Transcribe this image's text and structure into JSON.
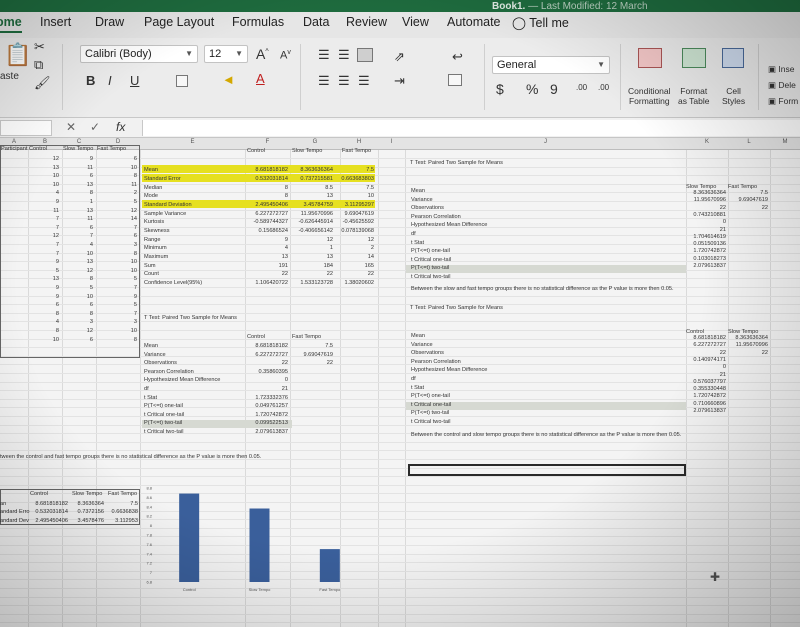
{
  "title_bar": {
    "file": "Book1.",
    "modified": "— Last Modified: 12 March"
  },
  "tabs": [
    "ome",
    "Insert",
    "Draw",
    "Page Layout",
    "Formulas",
    "Data",
    "Review",
    "View",
    "Automate"
  ],
  "tell_me": "Tell me",
  "ribbon": {
    "paste": "aste",
    "font_name": "Calibri (Body)",
    "font_size": "12",
    "grow_font": "A",
    "shrink_font": "A",
    "bold": "B",
    "italic": "I",
    "underline": "U",
    "number_format": "General",
    "currency": "$",
    "percent": "%",
    "comma": "9",
    "increase_decimal": ".00",
    "decrease_decimal": ".00",
    "conditional_formatting": [
      "Conditional",
      "Formatting"
    ],
    "format_as_table": [
      "Format",
      "as Table"
    ],
    "cell_styles": [
      "Cell",
      "Styles"
    ],
    "insert": "Inse",
    "delete": "Dele",
    "format": "Form"
  },
  "formula_bar": {
    "fx": "fx",
    "cancel": "✕",
    "enter": "✓"
  },
  "columns": [
    "A",
    "B",
    "C",
    "D",
    "E",
    "F",
    "G",
    "H",
    "I",
    "J",
    "K",
    "L",
    "M"
  ],
  "data_table": {
    "headers": [
      "Participant",
      "Control",
      "Slow Tempo",
      "Fast Tempo"
    ],
    "rows": [
      [
        "",
        "12",
        "9",
        "6"
      ],
      [
        "",
        "13",
        "11",
        "10"
      ],
      [
        "",
        "10",
        "6",
        "8"
      ],
      [
        "",
        "10",
        "13",
        "11"
      ],
      [
        "",
        "4",
        "8",
        "2"
      ],
      [
        "",
        "9",
        "1",
        "5"
      ],
      [
        "",
        "11",
        "13",
        "12"
      ],
      [
        "",
        "7",
        "11",
        "14"
      ],
      [
        "",
        "7",
        "6",
        "7"
      ],
      [
        "",
        "12",
        "7",
        "6"
      ],
      [
        "",
        "7",
        "4",
        "3"
      ],
      [
        "",
        "7",
        "10",
        "8"
      ],
      [
        "",
        "9",
        "13",
        "10"
      ],
      [
        "",
        "5",
        "12",
        "10"
      ],
      [
        "",
        "13",
        "8",
        "5"
      ],
      [
        "",
        "9",
        "5",
        "7"
      ],
      [
        "",
        "9",
        "10",
        "9"
      ],
      [
        "",
        "6",
        "6",
        "5"
      ],
      [
        "",
        "8",
        "8",
        "7"
      ],
      [
        "",
        "4",
        "3",
        "3"
      ],
      [
        "",
        "8",
        "12",
        "10"
      ],
      [
        "",
        "10",
        "6",
        "8"
      ]
    ]
  },
  "descriptive_stats": {
    "headers": [
      "Control",
      "Slow Tempo",
      "Fast Tempo"
    ],
    "rows": [
      [
        "Mean",
        "8.681818182",
        "8.363636364",
        "7.5"
      ],
      [
        "Standard Error",
        "0.532031814",
        "0.737215581",
        "0.663683803"
      ],
      [
        "Median",
        "8",
        "8.5",
        "7.5"
      ],
      [
        "Mode",
        "8",
        "13",
        "10"
      ],
      [
        "Standard Deviation",
        "2.495450406",
        "3.45784759",
        "3.11295297"
      ],
      [
        "Sample Variance",
        "6.227272727",
        "11.95670996",
        "9.69047619"
      ],
      [
        "Kurtosis",
        "-0.589744327",
        "-0.626445914",
        "-0.45625592"
      ],
      [
        "Skewness",
        "0.15686524",
        "-0.406656142",
        "0.078139068"
      ],
      [
        "Range",
        "9",
        "12",
        "12"
      ],
      [
        "Minimum",
        "4",
        "1",
        "2"
      ],
      [
        "Maximum",
        "13",
        "13",
        "14"
      ],
      [
        "Sum",
        "191",
        "184",
        "165"
      ],
      [
        "Count",
        "22",
        "22",
        "22"
      ],
      [
        "Confidence Level(95%)",
        "1.106420722",
        "1.533123728",
        "1.38020602"
      ]
    ]
  },
  "ttest_left": {
    "title": "T Test: Paired Two Sample for Means",
    "headers": [
      "Control",
      "Fast Tempo"
    ],
    "rows": [
      [
        "Mean",
        "8.681818182",
        "7.5"
      ],
      [
        "Variance",
        "6.227272727",
        "9.69047619"
      ],
      [
        "Observations",
        "22",
        "22"
      ],
      [
        "Pearson Correlation",
        "0.35860395",
        ""
      ],
      [
        "Hypothesized Mean Difference",
        "0",
        ""
      ],
      [
        "df",
        "21",
        ""
      ],
      [
        "t Stat",
        "1.723332376",
        ""
      ],
      [
        "P(T<=t) one-tail",
        "0.049761257",
        ""
      ],
      [
        "t Critical one-tail",
        "1.720742872",
        ""
      ],
      [
        "P(T<=t) two-tail",
        "0.099522513",
        ""
      ],
      [
        "t Critical two-tail",
        "2.079613837",
        ""
      ]
    ],
    "conclusion": "tween the control and fast tempo groups there is no statistical difference as the P value is more then 0.05."
  },
  "ttest_right_top": {
    "title": "T Test: Paired Two Sample for Means",
    "headers": [
      "Slow Tempo",
      "Fast Tempo"
    ],
    "labels": [
      "Mean",
      "Variance",
      "Observations",
      "Pearson Correlation",
      "Hypothesized Mean Difference",
      "df",
      "t Stat",
      "P(T<=t) one-tail",
      "t Critical one-tail",
      "P(T<=t) two-tail",
      "t Critical two-tail"
    ],
    "values": [
      [
        "8.363636364",
        "7.5"
      ],
      [
        "11.95670996",
        "9.69047619"
      ],
      [
        "22",
        "22"
      ],
      [
        "0.743210881",
        ""
      ],
      [
        "0",
        ""
      ],
      [
        "21",
        ""
      ],
      [
        "1.704614619",
        ""
      ],
      [
        "0.051509136",
        ""
      ],
      [
        "1.720742872",
        ""
      ],
      [
        "0.103018273",
        ""
      ],
      [
        "2.079613837",
        ""
      ]
    ],
    "conclusion": "Between the slow and fast tempo groups there is no statistical difference as the P value is more then 0.05."
  },
  "ttest_right_bottom": {
    "title": "T Test: Paired Two Sample for Means",
    "headers": [
      "Control",
      "Slow Tempo"
    ],
    "labels": [
      "Mean",
      "Variance",
      "Observations",
      "Pearson Correlation",
      "Hypothesized Mean Difference",
      "df",
      "t Stat",
      "P(T<=t) one-tail",
      "t Critical one-tail",
      "P(T<=t) two-tail",
      "t Critical two-tail"
    ],
    "values": [
      [
        "8.681818182",
        "8.363636364"
      ],
      [
        "6.227272727",
        "11.95670996"
      ],
      [
        "22",
        "22"
      ],
      [
        "0.140974171",
        ""
      ],
      [
        "0",
        ""
      ],
      [
        "21",
        ""
      ],
      [
        "0.576037797",
        ""
      ],
      [
        "0.355330448",
        ""
      ],
      [
        "1.720742872",
        ""
      ],
      [
        "0.710660896",
        ""
      ],
      [
        "2.079613837",
        ""
      ]
    ],
    "conclusion": "Between the control and slow tempo groups there is no statistical difference as the P value is more then 0.05."
  },
  "summary_table": {
    "headers": [
      "Control",
      "Slow Tempo",
      "Fast Tempo"
    ],
    "rows": [
      [
        "an",
        "8.681818182",
        "8.3636364",
        "7.5"
      ],
      [
        "andard Erro",
        "0.532031814",
        "0.7372156",
        "0.6636838"
      ],
      [
        "andard Dev",
        "2.495450406",
        "3.4578476",
        "3.112953"
      ]
    ]
  },
  "chart_data": {
    "type": "bar",
    "categories": [
      "Control",
      "Slow Tempo",
      "Fast Tempo"
    ],
    "values": [
      8.681818182,
      8.363636364,
      7.5
    ],
    "ylim": [
      6.8,
      8.8
    ],
    "yticks": [
      "8.8",
      "8.6",
      "8.4",
      "8.2",
      "8",
      "7.8",
      "7.6",
      "7.4",
      "7.2",
      "7",
      "6.8"
    ],
    "bar_color": "#3a5f9b",
    "title": "",
    "xlabel": "",
    "ylabel": ""
  }
}
